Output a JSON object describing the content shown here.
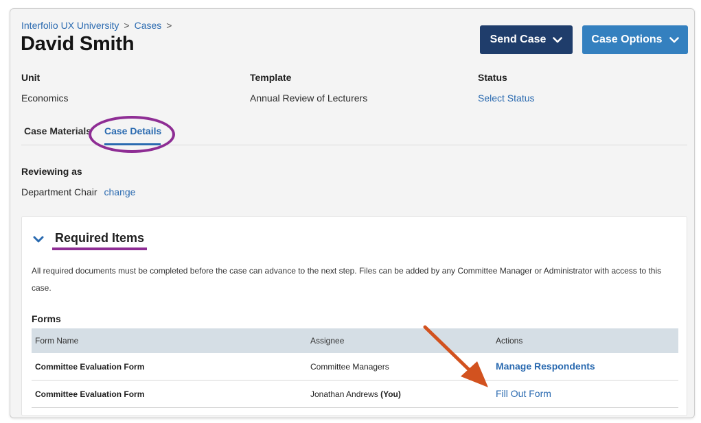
{
  "breadcrumb": {
    "items": [
      "Interfolio UX University",
      "Cases"
    ],
    "separator": ">"
  },
  "header": {
    "title": "David Smith",
    "send_case_label": "Send Case",
    "case_options_label": "Case Options"
  },
  "meta": {
    "unit": {
      "label": "Unit",
      "value": "Economics"
    },
    "template": {
      "label": "Template",
      "value": "Annual Review of Lecturers"
    },
    "status": {
      "label": "Status",
      "value": "Select Status"
    }
  },
  "tabs": [
    {
      "label": "Case Materials",
      "active": false
    },
    {
      "label": "Case Details",
      "active": true
    }
  ],
  "reviewing": {
    "label": "Reviewing as",
    "role": "Department Chair",
    "change_label": "change"
  },
  "required_items": {
    "title": "Required Items",
    "description": "All required documents must be completed before the case can advance to the next step. Files can be added by any Committee Manager or Administrator with access to this case.",
    "forms_label": "Forms",
    "columns": [
      "Form Name",
      "Assignee",
      "Actions"
    ],
    "rows": [
      {
        "form_name": "Committee Evaluation Form",
        "assignee": "Committee Managers",
        "assignee_suffix": "",
        "action": "Manage Respondents"
      },
      {
        "form_name": "Committee Evaluation Form",
        "assignee": "Jonathan Andrews",
        "assignee_suffix": "(You)",
        "action": "Fill Out Form"
      }
    ]
  },
  "colors": {
    "link": "#2a6ab0",
    "send_button": "#1f3d6b",
    "options_button": "#3480bf",
    "annotation_purple": "#8e2d94",
    "annotation_arrow": "#d2521f",
    "table_header": "#d5dee5"
  },
  "icons": {
    "dropdown": "chevron-down-icon",
    "section_toggle": "chevron-down-icon",
    "annotation": "arrow-annotation"
  }
}
